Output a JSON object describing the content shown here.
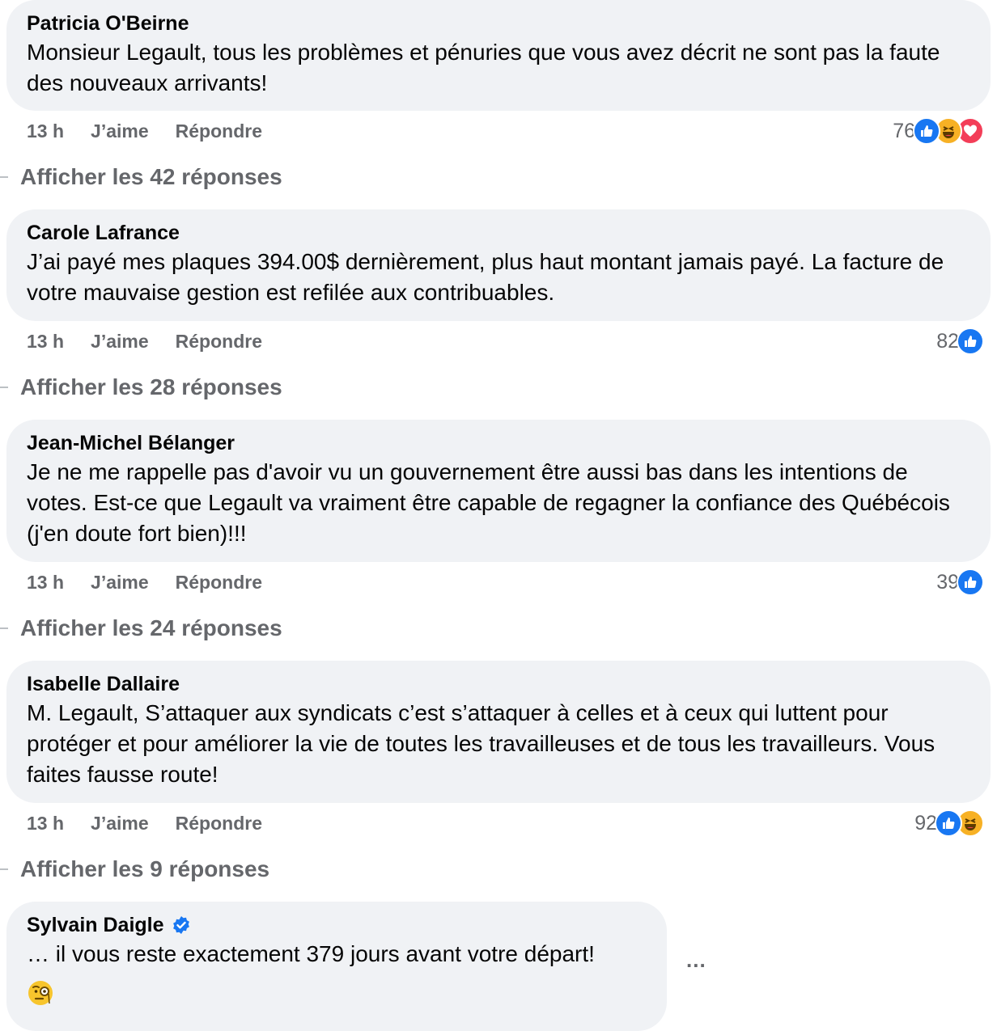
{
  "comments": [
    {
      "author": "Patricia O'Beirne",
      "text": "Monsieur Legault, tous les problèmes et pénuries que vous avez décrit ne sont pas la faute des nouveaux arrivants!",
      "time": "13 h",
      "like_label": "J’aime",
      "reply_label": "Répondre",
      "reaction_count": "76",
      "reactions": [
        "like-icon",
        "haha-icon",
        "love-icon"
      ],
      "replies_label": "Afficher les 42 réponses"
    },
    {
      "author": "Carole Lafrance",
      "text": "J’ai payé mes plaques 394.00$ dernièrement, plus haut montant jamais payé. La facture de votre mauvaise gestion est refilée aux contribuables.",
      "time": "13 h",
      "like_label": "J’aime",
      "reply_label": "Répondre",
      "reaction_count": "82",
      "reactions": [
        "like-icon"
      ],
      "replies_label": "Afficher les 28 réponses"
    },
    {
      "author": "Jean-Michel Bélanger",
      "text": "Je ne me rappelle pas d'avoir vu un gouvernement être aussi bas dans les intentions de votes. Est-ce que Legault va vraiment être capable de regagner la confiance des Québécois (j'en doute fort bien)!!!",
      "time": "13 h",
      "like_label": "J’aime",
      "reply_label": "Répondre",
      "reaction_count": "39",
      "reactions": [
        "like-icon"
      ],
      "replies_label": "Afficher les 24 réponses"
    },
    {
      "author": "Isabelle Dallaire",
      "text": "M. Legault, S’attaquer aux syndicats c’est s’attaquer à celles et à ceux qui luttent pour protéger et pour améliorer la vie de toutes les travailleuses et de tous les travailleurs. Vous faites fausse route!",
      "time": "13 h",
      "like_label": "J’aime",
      "reply_label": "Répondre",
      "reaction_count": "92",
      "reactions": [
        "like-icon",
        "haha-icon"
      ],
      "replies_label": "Afficher les 9 réponses"
    },
    {
      "author": "Sylvain Daigle",
      "verified": true,
      "text": "… il vous reste exactement 379 jours avant votre départ!",
      "emoji": "face-with-monocle-icon",
      "more_label": "..."
    }
  ],
  "colors": {
    "bubble": "#f0f2f5",
    "secondary_text": "#65676b",
    "like_blue": "#1877f2",
    "haha_yellow": "#f7b125",
    "love_red": "#f33e58"
  }
}
